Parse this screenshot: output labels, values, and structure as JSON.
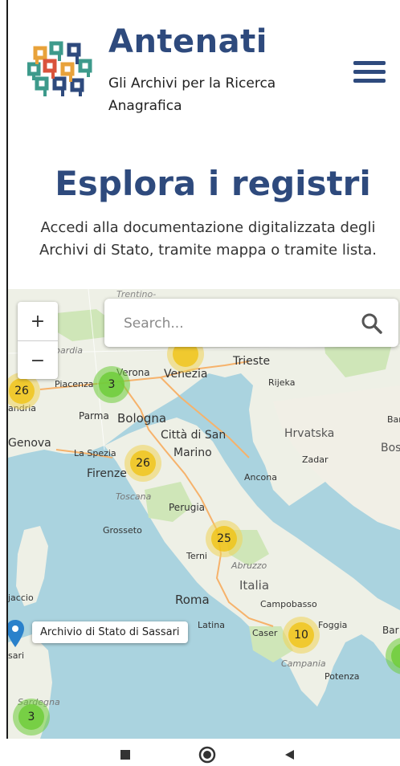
{
  "header": {
    "title": "Antenati",
    "subtitle": "Gli Archivi per la Ricerca Anagrafica",
    "logo_icon": "antenati-logo-icon",
    "menu_icon": "hamburger-menu-icon"
  },
  "hero": {
    "title": "Esplora i registri",
    "subtitle": "Accedi alla documentazione digitalizzata degli Archivi di Stato, tramite mappa o tramite lista."
  },
  "map": {
    "zoom_in": "+",
    "zoom_out": "−",
    "search_placeholder": "Search...",
    "search_icon": "search-icon",
    "tooltip": "Archivio di Stato di Sassari",
    "clusters": {
      "verona": "3",
      "piacenza": "26",
      "firenze": "26",
      "abruzzo": "25",
      "caserta": "10",
      "sardegna": "3"
    },
    "labels": {
      "trentino": "Trentino-",
      "lombardia": "bardia",
      "verona": "Verona",
      "venezia": "Venezia",
      "trieste": "Trieste",
      "rijeka": "Rijeka",
      "piacenza": "Piacenza",
      "parma": "Parma",
      "bologna": "Bologna",
      "andria": "andria",
      "genova": "Genova",
      "la_spezia": "La Spezia",
      "citta": "Città di San",
      "marino": "Marino",
      "hrvatska": "Hrvatska",
      "zadar": "Zadar",
      "bos": "Bos",
      "ban": "Ban",
      "firenze": "Firenze",
      "ancona": "Ancona",
      "toscana": "Toscana",
      "perugia": "Perugia",
      "grosseto": "Grosseto",
      "terni": "Terni",
      "abruzzo": "Abruzzo",
      "italia": "Italia",
      "roma": "Roma",
      "campobasso": "Campobasso",
      "latina": "Latina",
      "caserta": "Caser",
      "foggia": "Foggia",
      "bar": "Bar",
      "campania": "Campania",
      "potenza": "Potenza",
      "ajaccio": "jaccio",
      "sari": "sari",
      "sardegna": "Sardegna"
    }
  },
  "nav": {
    "recent_icon": "square-recent-icon",
    "home_icon": "circle-home-icon",
    "back_icon": "triangle-back-icon"
  }
}
